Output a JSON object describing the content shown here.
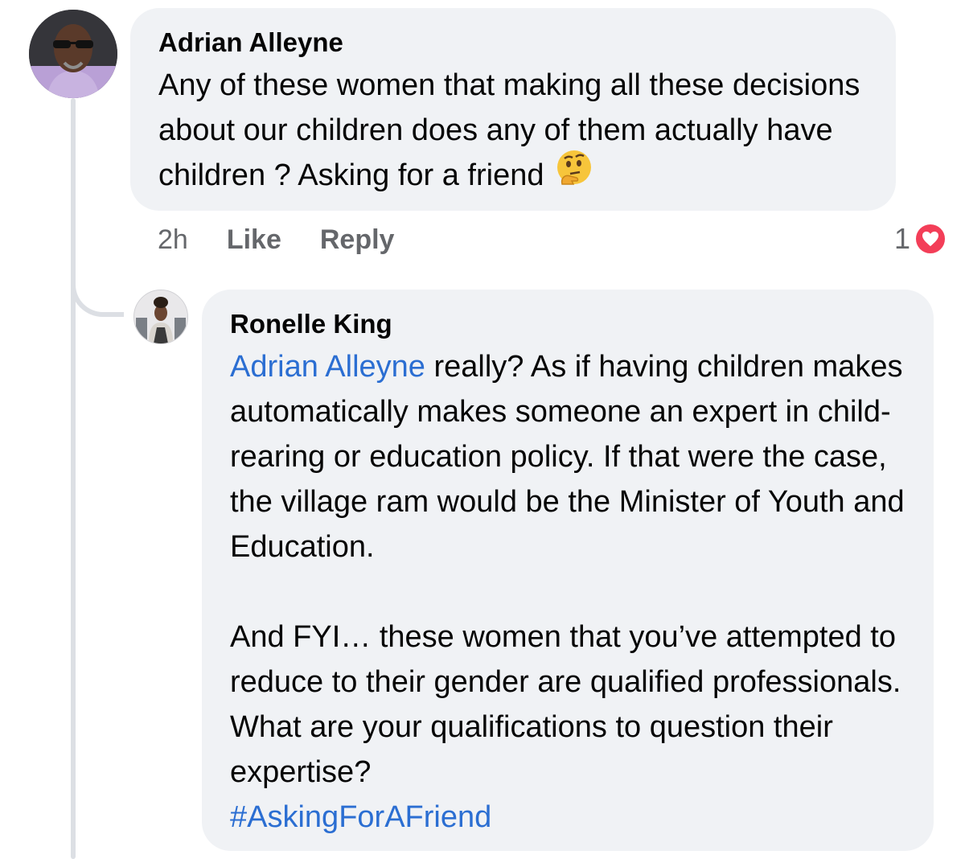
{
  "comments": [
    {
      "author": "Adrian Alleyne",
      "text": "Any of these women that making all these decisions about our children does any of them actually have children ? Asking for a friend",
      "emoji": "thinking-face",
      "time": "2h",
      "like_label": "Like",
      "reply_label": "Reply",
      "reaction_count": "1",
      "reaction_type": "love"
    }
  ],
  "reply": {
    "author": "Ronelle King",
    "mention": "Adrian Alleyne",
    "text_part1": " really? As if having children makes automatically makes someone an expert in child-rearing or education policy. If that were the case, the village ram would be the Minister of Youth and Education.",
    "text_part2": "And FYI… these women that you’ve attempted to reduce to their gender are qualified professionals. What are your qualifications to question their expertise?",
    "hashtag": "#AskingForAFriend"
  },
  "colors": {
    "bubble": "#f0f2f5",
    "link": "#2b6ed2",
    "meta": "#65676b",
    "love": "#f33e58",
    "thread_line": "#dcdfe4"
  }
}
